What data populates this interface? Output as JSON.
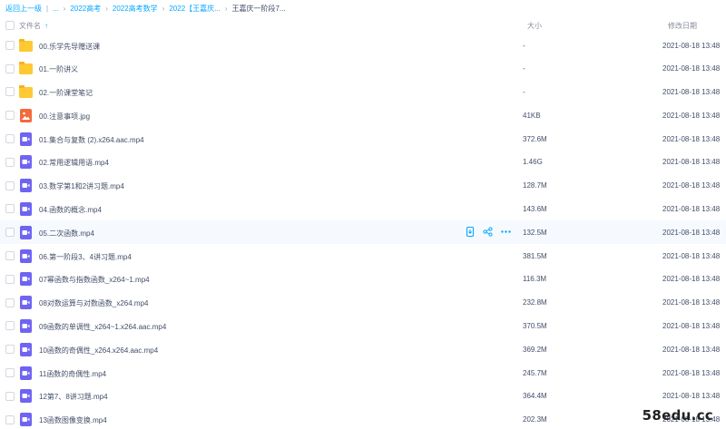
{
  "breadcrumb": {
    "back": "返回上一级",
    "items": [
      "...",
      "2022高考",
      "2022高考数学",
      "2022【王嘉庆..."
    ],
    "current": "王嘉庆一阶段7..."
  },
  "header": {
    "name": "文件名",
    "sort_icon": "sort-up-arrow-icon",
    "size": "大小",
    "date": "修改日期"
  },
  "files": [
    {
      "type": "folder",
      "name": "00.乐学先导赠送课",
      "size": "-",
      "date": "2021-08-18 13:48"
    },
    {
      "type": "folder",
      "name": "01.一阶讲义",
      "size": "-",
      "date": "2021-08-18 13:48"
    },
    {
      "type": "folder",
      "name": "02.一阶课堂笔记",
      "size": "-",
      "date": "2021-08-18 13:48"
    },
    {
      "type": "image",
      "name": "00.注意事项.jpg",
      "size": "41KB",
      "date": "2021-08-18 13:48"
    },
    {
      "type": "video",
      "name": "01.集合与复数 (2).x264.aac.mp4",
      "size": "372.6M",
      "date": "2021-08-18 13:48"
    },
    {
      "type": "video",
      "name": "02.常用逻辑用语.mp4",
      "size": "1.46G",
      "date": "2021-08-18 13:48"
    },
    {
      "type": "video",
      "name": "03.数学第1和2讲习题.mp4",
      "size": "128.7M",
      "date": "2021-08-18 13:48"
    },
    {
      "type": "video",
      "name": "04.函数的概念.mp4",
      "size": "143.6M",
      "date": "2021-08-18 13:48"
    },
    {
      "type": "video",
      "name": "05.二次函数.mp4",
      "size": "132.5M",
      "date": "2021-08-18 13:48"
    },
    {
      "type": "video",
      "name": "06.第一阶段3、4讲习题.mp4",
      "size": "381.5M",
      "date": "2021-08-18 13:48"
    },
    {
      "type": "video",
      "name": "07幂函数与指数函数_x264~1.mp4",
      "size": "116.3M",
      "date": "2021-08-18 13:48"
    },
    {
      "type": "video",
      "name": "08对数运算与对数函数_x264.mp4",
      "size": "232.8M",
      "date": "2021-08-18 13:48"
    },
    {
      "type": "video",
      "name": "09函数的单调性_x264~1.x264.aac.mp4",
      "size": "370.5M",
      "date": "2021-08-18 13:48"
    },
    {
      "type": "video",
      "name": "10函数的奇偶性_x264.x264.aac.mp4",
      "size": "369.2M",
      "date": "2021-08-18 13:48"
    },
    {
      "type": "video",
      "name": "11函数的奇偶性.mp4",
      "size": "245.7M",
      "date": "2021-08-18 13:48"
    },
    {
      "type": "video",
      "name": "12第7、8讲习题.mp4",
      "size": "364.4M",
      "date": "2021-08-18 13:48"
    },
    {
      "type": "video",
      "name": "13函数图像变换.mp4",
      "size": "202.3M",
      "date": "2021-08-18 13:48"
    }
  ],
  "hover_row_index": 8,
  "row_actions": [
    "download-icon",
    "share-icon",
    "more-icon"
  ],
  "watermark": "58edu.cc",
  "colors": {
    "accent": "#06a7ff",
    "folder": "#ffc933",
    "video": "#6f64f2",
    "image": "#f26a3d",
    "hover": "#f6faff"
  }
}
